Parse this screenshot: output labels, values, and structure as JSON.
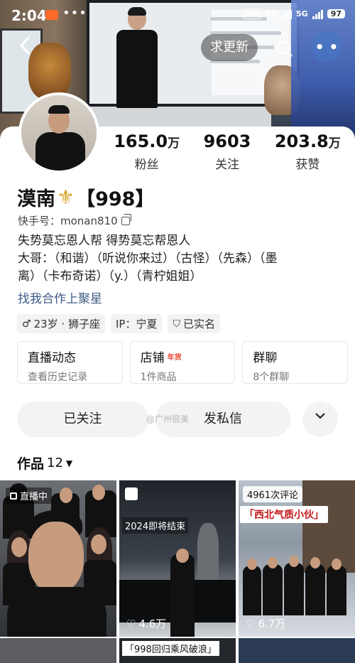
{
  "status_bar": {
    "time": "2:04",
    "network_1": "5G",
    "network_2": "5G",
    "battery": "97",
    "hd_label": "HD"
  },
  "header": {
    "update_button": "求更新"
  },
  "profile": {
    "name": "漠南",
    "name_suffix": "【998】",
    "kuaishou_id_label": "快手号：monan810",
    "stats": [
      {
        "value": "165.0",
        "unit": "万",
        "label": "粉丝"
      },
      {
        "value": "9603",
        "unit": "",
        "label": "关注"
      },
      {
        "value": "203.8",
        "unit": "万",
        "label": "获赞"
      }
    ],
    "bio_lines": [
      "失势莫忘恩人帮 得势莫忘帮恩人",
      "大哥：（和谐）（听说你来过）（古怪）（先森）（墨",
      "离）（卡布奇诺）（y.）（青柠姐姐）"
    ],
    "business_link": "找我合作上聚星",
    "tags": {
      "age_sign": "23岁 · 狮子座",
      "ip": "IP：宁夏",
      "verified": "已实名"
    }
  },
  "boxes": [
    {
      "title": "直播动态",
      "subtitle": "查看历史记录",
      "badge": ""
    },
    {
      "title": "店铺",
      "subtitle": "1件商品",
      "badge": "年货"
    },
    {
      "title": "群聊",
      "subtitle": "8个群聊",
      "badge": ""
    }
  ],
  "actions": {
    "followed": "已关注",
    "message": "发私信",
    "watermark": "@广州很美"
  },
  "works": {
    "label": "作品",
    "count": "12"
  },
  "tiles": [
    {
      "live_label": "直播中",
      "likes": ""
    },
    {
      "caption": "2024即将结束",
      "likes": "4.6万"
    },
    {
      "comments": "4961次评论",
      "red_caption": "「西北气质小伙」",
      "likes": "6.7万"
    }
  ],
  "bottom_row": {
    "caption": "「998回归乘风破浪」"
  },
  "colors": {
    "accent_link": "#3e5a86",
    "badge_red": "#e8412c",
    "gold": "#d8a62a"
  }
}
